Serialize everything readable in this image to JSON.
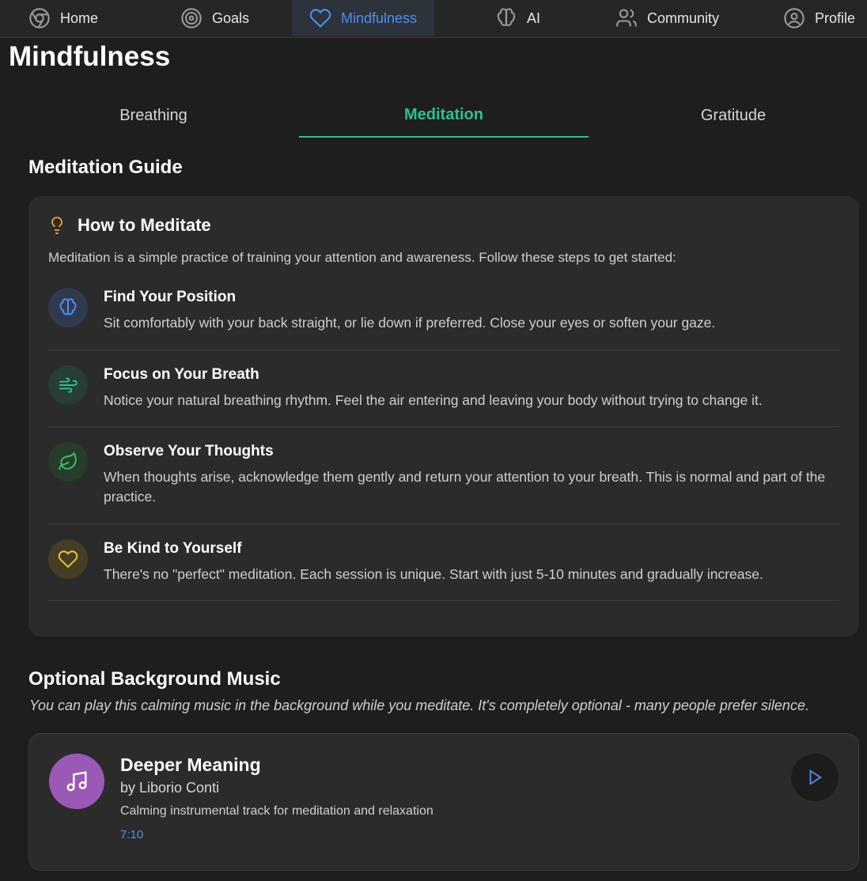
{
  "nav": {
    "items": [
      {
        "label": "Home",
        "icon": "chrome-icon"
      },
      {
        "label": "Goals",
        "icon": "target-icon"
      },
      {
        "label": "Mindfulness",
        "icon": "heart-icon",
        "active": true
      },
      {
        "label": "AI",
        "icon": "brain-icon"
      },
      {
        "label": "Community",
        "icon": "users-icon"
      },
      {
        "label": "Profile",
        "icon": "user-circle-icon"
      }
    ]
  },
  "page": {
    "title": "Mindfulness"
  },
  "tabs": [
    {
      "label": "Breathing"
    },
    {
      "label": "Meditation",
      "active": true
    },
    {
      "label": "Gratitude"
    }
  ],
  "guide": {
    "section_title": "Meditation Guide",
    "heading": "How to Meditate",
    "heading_icon": "lightbulb-icon",
    "intro": "Meditation is a simple practice of training your attention and awareness. Follow these steps to get started:",
    "steps": [
      {
        "title": "Find Your Position",
        "text": "Sit comfortably with your back straight, or lie down if preferred. Close your eyes or soften your gaze.",
        "icon": "brain-icon",
        "color": "#4d8ff0"
      },
      {
        "title": "Focus on Your Breath",
        "text": "Notice your natural breathing rhythm. Feel the air entering and leaving your body without trying to change it.",
        "icon": "wind-icon",
        "color": "#2ebf96"
      },
      {
        "title": "Observe Your Thoughts",
        "text": "When thoughts arise, acknowledge them gently and return your attention to your breath. This is normal and part of the practice.",
        "icon": "leaf-icon",
        "color": "#3fbf5f"
      },
      {
        "title": "Be Kind to Yourself",
        "text": "There's no \"perfect\" meditation. Each session is unique. Start with just 5-10 minutes and gradually increase.",
        "icon": "heart-icon",
        "color": "#e8c23a"
      }
    ]
  },
  "music": {
    "section_title": "Optional Background Music",
    "description": "You can play this calming music in the background while you meditate. It's completely optional - many people prefer silence.",
    "track": {
      "title": "Deeper Meaning",
      "artist": "by Liborio Conti",
      "description": "Calming instrumental track for meditation and relaxation",
      "duration": "7:10",
      "art_icon": "music-note-icon",
      "play_icon": "play-icon"
    }
  },
  "colors": {
    "accent": "#2ebf96",
    "link": "#4d8ff0",
    "background": "#1e1e1e",
    "card": "#2b2b2b"
  }
}
